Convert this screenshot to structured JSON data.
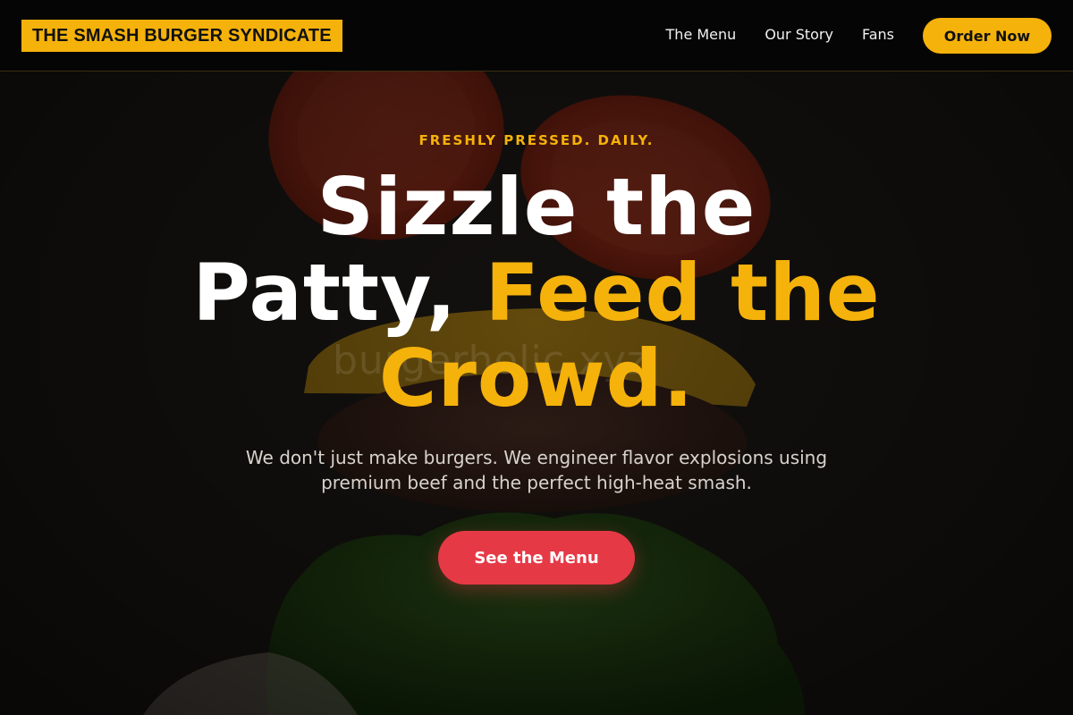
{
  "header": {
    "logo": "THE SMASH BURGER SYNDICATE",
    "nav": [
      "The Menu",
      "Our Story",
      "Fans"
    ],
    "order_button": "Order Now"
  },
  "hero": {
    "eyebrow": "FRESHLY PRESSED. DAILY.",
    "headline_line1": "Sizzle the",
    "headline_white": "Patty, ",
    "headline_accent_line2": "Feed the",
    "headline_accent_line3": "Crowd.",
    "subtext": "We don't just make burgers. We engineer flavor explosions using premium beef and the perfect high-heat smash.",
    "cta_label": "See the Menu",
    "watermark": "burgerholic.xyz"
  },
  "colors": {
    "accent": "#f5b20a",
    "cta": "#e63946",
    "header_bg": "#050505"
  },
  "background": {
    "image": "flying-burger-ingredients: tomato slices, cheese on beef patty, lettuce"
  }
}
